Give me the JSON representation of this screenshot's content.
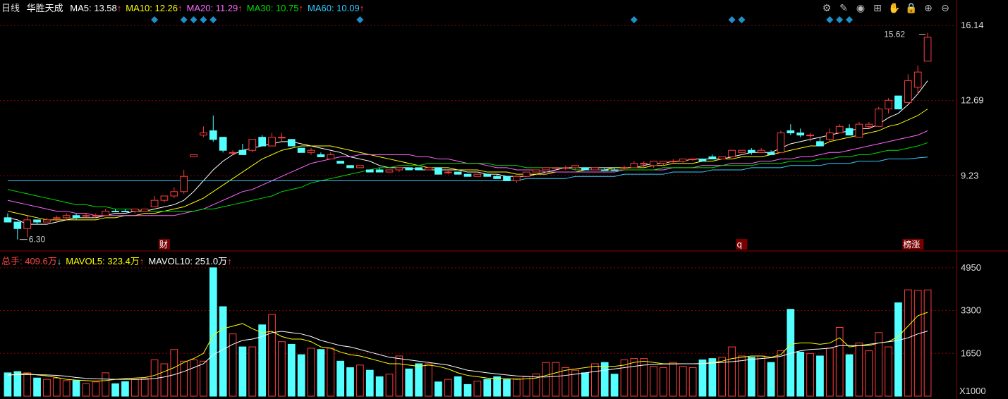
{
  "period_label": "日线",
  "stock_name": "华胜天成",
  "ma_legend": [
    {
      "label": "MA5: 13.58",
      "arrow": "↑",
      "color": "#ffffff"
    },
    {
      "label": "MA10: 12.26",
      "arrow": "↑",
      "color": "#ffff00"
    },
    {
      "label": "MA20: 11.29",
      "arrow": "↑",
      "color": "#ff66ff"
    },
    {
      "label": "MA30: 10.75",
      "arrow": "↑",
      "color": "#00dd00"
    },
    {
      "label": "MA60: 10.09",
      "arrow": "↑",
      "color": "#33ccff"
    }
  ],
  "vol_legend": [
    {
      "label": "总手: 409.6万",
      "arrow": "↓",
      "color": "#ff4444"
    },
    {
      "label": "MAVOL5: 323.4万",
      "arrow": "↑",
      "color": "#ffff00"
    },
    {
      "label": "MAVOL10: 251.0万",
      "arrow": "↑",
      "color": "#ffffff"
    }
  ],
  "toolbar": [
    "gear-icon",
    "pen-icon",
    "eye-icon",
    "gift-icon",
    "hand-icon",
    "lock-icon",
    "zoom-in-icon",
    "zoom-out-icon"
  ],
  "toolbar_glyphs": [
    "⚙",
    "✎",
    "◉",
    "⊞",
    "✋",
    "🔒",
    "⊕",
    "⊖"
  ],
  "colors": {
    "up": "#ff3c3c",
    "down": "#54ffff",
    "bg": "#000000",
    "grid": "#8b0000",
    "axis_text": "#dddddd"
  },
  "chart_data": {
    "type": "candlestick",
    "price_axis": {
      "ticks": [
        "16.14",
        "12.69",
        "9.23"
      ],
      "range": [
        5.9,
        16.6
      ]
    },
    "volume_axis": {
      "ticks": [
        "4950",
        "3300",
        "1650"
      ],
      "unit_label": "X1000",
      "range": [
        0,
        5000
      ]
    },
    "annotations": {
      "high_label": "15.62",
      "low_label": "6.30",
      "events": [
        "财",
        "q",
        "榜涨"
      ]
    },
    "candles": [
      [
        7.3,
        7.5,
        7.2,
        7.1,
        "d",
        900
      ],
      [
        7.1,
        7.1,
        6.3,
        6.8,
        "d",
        950
      ],
      [
        6.8,
        7.4,
        6.4,
        7.2,
        "u",
        900
      ],
      [
        7.2,
        7.2,
        7.0,
        7.1,
        "d",
        700
      ],
      [
        7.1,
        7.3,
        7.1,
        7.2,
        "u",
        650
      ],
      [
        7.3,
        7.4,
        7.1,
        7.3,
        "u",
        700
      ],
      [
        7.3,
        7.5,
        7.2,
        7.4,
        "u",
        600
      ],
      [
        7.4,
        7.5,
        7.2,
        7.3,
        "d",
        600
      ],
      [
        7.4,
        7.5,
        7.3,
        7.4,
        "u",
        480
      ],
      [
        7.4,
        7.5,
        7.3,
        7.4,
        "u",
        550
      ],
      [
        7.4,
        7.7,
        7.4,
        7.6,
        "u",
        900
      ],
      [
        7.6,
        7.7,
        7.6,
        7.6,
        "d",
        480
      ],
      [
        7.6,
        7.7,
        7.6,
        7.6,
        "d",
        560
      ],
      [
        7.6,
        7.7,
        7.5,
        7.7,
        "u",
        640
      ],
      [
        7.6,
        7.7,
        7.6,
        7.7,
        "u",
        700
      ],
      [
        7.8,
        8.3,
        7.8,
        8.1,
        "u",
        1400
      ],
      [
        8.1,
        8.3,
        8.0,
        8.3,
        "u",
        1250
      ],
      [
        8.3,
        8.7,
        8.2,
        8.5,
        "u",
        1800
      ],
      [
        8.5,
        9.5,
        8.4,
        9.2,
        "u",
        1350
      ],
      [
        10.1,
        10.2,
        10.1,
        10.2,
        "u",
        1400
      ],
      [
        11.1,
        11.5,
        11.0,
        11.2,
        "u",
        1350
      ],
      [
        11.3,
        12.0,
        10.8,
        10.9,
        "d",
        4950
      ],
      [
        11.0,
        11.0,
        10.3,
        10.4,
        "d",
        3450
      ],
      [
        10.3,
        10.4,
        10.2,
        10.3,
        "u",
        2400
      ],
      [
        10.4,
        10.7,
        10.2,
        10.2,
        "d",
        1900
      ],
      [
        10.4,
        10.9,
        10.3,
        10.9,
        "u",
        1900
      ],
      [
        11.0,
        11.1,
        10.6,
        10.6,
        "d",
        2750
      ],
      [
        10.6,
        11.2,
        10.6,
        11.0,
        "u",
        3150
      ],
      [
        11.0,
        11.2,
        10.8,
        11.0,
        "u",
        2100
      ],
      [
        10.9,
        10.9,
        10.6,
        10.6,
        "d",
        2000
      ],
      [
        10.5,
        10.5,
        10.3,
        10.3,
        "d",
        1600
      ],
      [
        10.3,
        10.5,
        10.2,
        10.4,
        "u",
        1850
      ],
      [
        10.2,
        10.3,
        10.1,
        10.1,
        "d",
        1800
      ],
      [
        10.0,
        10.3,
        10.0,
        10.2,
        "u",
        1850
      ],
      [
        9.9,
        9.9,
        9.8,
        9.8,
        "d",
        1350
      ],
      [
        9.7,
        9.7,
        9.6,
        9.6,
        "d",
        1100
      ],
      [
        9.6,
        9.7,
        9.6,
        9.7,
        "u",
        1200
      ],
      [
        9.5,
        9.5,
        9.4,
        9.4,
        "d",
        1000
      ],
      [
        9.5,
        9.6,
        9.4,
        9.4,
        "d",
        750
      ],
      [
        9.4,
        9.5,
        9.4,
        9.5,
        "u",
        850
      ],
      [
        9.5,
        9.6,
        9.4,
        9.6,
        "u",
        1550
      ],
      [
        9.6,
        9.6,
        9.5,
        9.5,
        "d",
        1050
      ],
      [
        9.6,
        9.6,
        9.5,
        9.5,
        "d",
        1250
      ],
      [
        9.5,
        9.6,
        9.5,
        9.6,
        "u",
        1250
      ],
      [
        9.6,
        9.6,
        9.3,
        9.3,
        "d",
        550
      ],
      [
        9.4,
        9.5,
        9.3,
        9.4,
        "u",
        650
      ],
      [
        9.4,
        9.4,
        9.3,
        9.3,
        "d",
        750
      ],
      [
        9.3,
        9.3,
        9.2,
        9.2,
        "d",
        450
      ],
      [
        9.2,
        9.3,
        9.2,
        9.3,
        "u",
        580
      ],
      [
        9.3,
        9.3,
        9.2,
        9.2,
        "d",
        650
      ],
      [
        9.2,
        9.3,
        9.1,
        9.1,
        "d",
        750
      ],
      [
        9.2,
        9.2,
        9.0,
        9.0,
        "d",
        640
      ],
      [
        9.0,
        9.2,
        8.9,
        9.2,
        "u",
        670
      ],
      [
        9.2,
        9.4,
        9.2,
        9.4,
        "u",
        750
      ],
      [
        9.4,
        9.5,
        9.4,
        9.5,
        "u",
        860
      ],
      [
        9.5,
        9.6,
        9.5,
        9.6,
        "u",
        1300
      ],
      [
        9.6,
        9.6,
        9.6,
        9.6,
        "u",
        1300
      ],
      [
        9.6,
        9.7,
        9.5,
        9.6,
        "u",
        1100
      ],
      [
        9.6,
        9.7,
        9.5,
        9.7,
        "u",
        1000
      ],
      [
        9.6,
        9.6,
        9.5,
        9.5,
        "d",
        900
      ],
      [
        9.5,
        9.6,
        9.5,
        9.6,
        "u",
        1250
      ],
      [
        9.5,
        9.6,
        9.5,
        9.5,
        "d",
        1300
      ],
      [
        9.5,
        9.6,
        9.5,
        9.5,
        "d",
        850
      ],
      [
        9.6,
        9.7,
        9.5,
        9.6,
        "u",
        1400
      ],
      [
        9.6,
        9.9,
        9.6,
        9.8,
        "u",
        1450
      ],
      [
        9.8,
        9.9,
        9.6,
        9.8,
        "u",
        1450
      ],
      [
        9.7,
        9.9,
        9.6,
        9.9,
        "u",
        1150
      ],
      [
        9.9,
        9.9,
        9.7,
        9.8,
        "u",
        1100
      ],
      [
        9.9,
        10.0,
        9.8,
        9.9,
        "u",
        1300
      ],
      [
        9.9,
        10.0,
        9.8,
        10.0,
        "u",
        1150
      ],
      [
        10.0,
        10.0,
        9.9,
        10.0,
        "u",
        1100
      ],
      [
        10.0,
        10.0,
        9.9,
        9.9,
        "d",
        1400
      ],
      [
        10.1,
        10.2,
        10.0,
        10.0,
        "d",
        1450
      ],
      [
        10.0,
        10.1,
        10.0,
        10.1,
        "u",
        1500
      ],
      [
        10.1,
        10.4,
        10.1,
        10.4,
        "u",
        1900
      ],
      [
        10.3,
        10.4,
        10.3,
        10.4,
        "u",
        1550
      ],
      [
        10.4,
        10.5,
        10.2,
        10.3,
        "d",
        1500
      ],
      [
        10.3,
        10.5,
        10.3,
        10.4,
        "u",
        1550
      ],
      [
        10.3,
        10.4,
        10.2,
        10.2,
        "d",
        1300
      ],
      [
        10.3,
        11.3,
        10.3,
        11.2,
        "u",
        1750
      ],
      [
        11.3,
        11.6,
        11.1,
        11.2,
        "d",
        3350
      ],
      [
        11.2,
        11.4,
        11.0,
        11.1,
        "d",
        1700
      ],
      [
        11.1,
        11.2,
        10.8,
        11.1,
        "u",
        1650
      ],
      [
        10.8,
        11.0,
        10.6,
        10.6,
        "d",
        1550
      ],
      [
        10.9,
        11.4,
        10.8,
        11.2,
        "u",
        1850
      ],
      [
        11.2,
        11.6,
        11.2,
        11.5,
        "u",
        2650
      ],
      [
        11.4,
        11.6,
        11.1,
        11.1,
        "d",
        1600
      ],
      [
        11.0,
        11.7,
        11.0,
        11.6,
        "u",
        2050
      ],
      [
        11.6,
        11.7,
        11.4,
        11.5,
        "u",
        1750
      ],
      [
        11.5,
        12.4,
        11.5,
        12.3,
        "u",
        2450
      ],
      [
        12.3,
        12.8,
        12.1,
        12.7,
        "u",
        1900
      ],
      [
        12.9,
        12.9,
        12.3,
        12.3,
        "d",
        3600
      ],
      [
        12.6,
        13.9,
        12.6,
        13.6,
        "u",
        4100
      ],
      [
        13.3,
        14.3,
        13.0,
        14.0,
        "u",
        4080
      ],
      [
        14.5,
        15.8,
        14.5,
        15.6,
        "u",
        4096
      ]
    ],
    "ma5": [
      7.3,
      7.2,
      7.0,
      7.0,
      7.0,
      7.1,
      7.2,
      7.3,
      7.3,
      7.3,
      7.4,
      7.5,
      7.5,
      7.6,
      7.6,
      7.7,
      7.8,
      7.9,
      8.1,
      8.5,
      9.0,
      9.5,
      9.9,
      10.2,
      10.4,
      10.5,
      10.6,
      10.7,
      10.8,
      10.8,
      10.7,
      10.6,
      10.5,
      10.4,
      10.3,
      10.1,
      10.0,
      9.9,
      9.7,
      9.6,
      9.6,
      9.6,
      9.5,
      9.5,
      9.5,
      9.5,
      9.5,
      9.4,
      9.4,
      9.3,
      9.3,
      9.2,
      9.2,
      9.2,
      9.3,
      9.4,
      9.5,
      9.6,
      9.6,
      9.6,
      9.6,
      9.6,
      9.6,
      9.6,
      9.6,
      9.7,
      9.8,
      9.8,
      9.9,
      9.9,
      10.0,
      10.0,
      10.0,
      10.0,
      10.1,
      10.2,
      10.3,
      10.3,
      10.3,
      10.5,
      10.7,
      10.8,
      10.9,
      11.0,
      11.1,
      11.2,
      11.3,
      11.4,
      11.4,
      11.6,
      11.9,
      12.1,
      12.5,
      13.0,
      13.6
    ],
    "ma10": [
      7.6,
      7.5,
      7.4,
      7.3,
      7.2,
      7.2,
      7.2,
      7.2,
      7.2,
      7.2,
      7.3,
      7.3,
      7.4,
      7.4,
      7.5,
      7.5,
      7.6,
      7.7,
      7.8,
      8.0,
      8.2,
      8.5,
      8.8,
      9.1,
      9.4,
      9.7,
      10.0,
      10.2,
      10.4,
      10.5,
      10.6,
      10.6,
      10.6,
      10.6,
      10.5,
      10.4,
      10.3,
      10.2,
      10.1,
      10.0,
      9.9,
      9.8,
      9.7,
      9.6,
      9.6,
      9.6,
      9.5,
      9.5,
      9.5,
      9.4,
      9.4,
      9.4,
      9.3,
      9.3,
      9.3,
      9.3,
      9.4,
      9.4,
      9.4,
      9.5,
      9.5,
      9.5,
      9.6,
      9.6,
      9.6,
      9.6,
      9.7,
      9.7,
      9.8,
      9.8,
      9.8,
      9.9,
      9.9,
      10.0,
      10.0,
      10.1,
      10.1,
      10.1,
      10.2,
      10.3,
      10.4,
      10.5,
      10.6,
      10.6,
      10.8,
      10.9,
      11.0,
      11.1,
      11.2,
      11.3,
      11.5,
      11.6,
      11.8,
      12.0,
      12.3
    ],
    "ma20": [
      8.1,
      8.0,
      7.9,
      7.8,
      7.7,
      7.6,
      7.6,
      7.5,
      7.5,
      7.4,
      7.4,
      7.4,
      7.4,
      7.4,
      7.4,
      7.4,
      7.4,
      7.4,
      7.5,
      7.6,
      7.7,
      7.9,
      8.1,
      8.3,
      8.5,
      8.6,
      8.8,
      9.0,
      9.2,
      9.4,
      9.6,
      9.8,
      9.9,
      10.0,
      10.1,
      10.1,
      10.2,
      10.2,
      10.2,
      10.2,
      10.2,
      10.2,
      10.1,
      10.1,
      10.0,
      10.0,
      9.9,
      9.8,
      9.8,
      9.7,
      9.6,
      9.6,
      9.5,
      9.5,
      9.5,
      9.4,
      9.4,
      9.4,
      9.4,
      9.4,
      9.4,
      9.4,
      9.4,
      9.5,
      9.5,
      9.5,
      9.5,
      9.5,
      9.6,
      9.6,
      9.6,
      9.7,
      9.7,
      9.7,
      9.8,
      9.8,
      9.8,
      9.9,
      9.9,
      10.0,
      10.0,
      10.1,
      10.1,
      10.2,
      10.3,
      10.3,
      10.4,
      10.5,
      10.6,
      10.7,
      10.8,
      10.9,
      11.0,
      11.1,
      11.3
    ],
    "ma30": [
      8.6,
      8.5,
      8.4,
      8.3,
      8.2,
      8.1,
      8.0,
      7.9,
      7.9,
      7.8,
      7.8,
      7.7,
      7.7,
      7.7,
      7.6,
      7.6,
      7.6,
      7.6,
      7.6,
      7.6,
      7.7,
      7.7,
      7.8,
      7.9,
      8.0,
      8.1,
      8.2,
      8.3,
      8.5,
      8.6,
      8.7,
      8.9,
      9.0,
      9.1,
      9.2,
      9.3,
      9.4,
      9.5,
      9.6,
      9.6,
      9.7,
      9.7,
      9.7,
      9.8,
      9.8,
      9.8,
      9.8,
      9.8,
      9.8,
      9.8,
      9.7,
      9.7,
      9.7,
      9.6,
      9.6,
      9.6,
      9.6,
      9.6,
      9.5,
      9.5,
      9.5,
      9.5,
      9.5,
      9.5,
      9.5,
      9.5,
      9.5,
      9.6,
      9.6,
      9.6,
      9.6,
      9.6,
      9.6,
      9.7,
      9.7,
      9.7,
      9.7,
      9.8,
      9.8,
      9.8,
      9.9,
      9.9,
      9.9,
      10.0,
      10.0,
      10.1,
      10.1,
      10.2,
      10.2,
      10.3,
      10.4,
      10.4,
      10.5,
      10.6,
      10.75
    ],
    "ma60": [
      9.0,
      9.0,
      9.0,
      9.0,
      9.0,
      9.0,
      9.0,
      9.0,
      9.0,
      9.0,
      9.0,
      9.0,
      9.0,
      9.0,
      9.0,
      9.0,
      9.0,
      9.0,
      9.0,
      9.0,
      9.0,
      9.0,
      9.0,
      9.0,
      9.0,
      9.0,
      9.0,
      9.0,
      9.0,
      9.0,
      9.0,
      9.0,
      9.0,
      9.0,
      9.0,
      9.0,
      9.0,
      9.0,
      9.0,
      9.0,
      9.0,
      9.0,
      9.0,
      9.0,
      9.0,
      9.0,
      9.0,
      9.0,
      9.0,
      9.0,
      9.0,
      9.0,
      9.0,
      9.1,
      9.1,
      9.1,
      9.1,
      9.1,
      9.2,
      9.2,
      9.2,
      9.2,
      9.2,
      9.3,
      9.3,
      9.3,
      9.3,
      9.3,
      9.4,
      9.4,
      9.4,
      9.4,
      9.5,
      9.5,
      9.5,
      9.5,
      9.6,
      9.6,
      9.6,
      9.6,
      9.7,
      9.7,
      9.7,
      9.7,
      9.8,
      9.8,
      9.8,
      9.9,
      9.9,
      9.9,
      10.0,
      10.0,
      10.0,
      10.05,
      10.09
    ],
    "mavol5": [
      800,
      850,
      870,
      820,
      780,
      720,
      650,
      620,
      600,
      580,
      600,
      650,
      680,
      700,
      720,
      800,
      950,
      1100,
      1300,
      1450,
      1650,
      2350,
      2600,
      2700,
      2800,
      2600,
      2450,
      2500,
      2300,
      2200,
      2200,
      2100,
      1900,
      1850,
      1700,
      1600,
      1550,
      1450,
      1350,
      1250,
      1250,
      1200,
      1150,
      1200,
      1150,
      1050,
      900,
      800,
      750,
      700,
      680,
      680,
      650,
      670,
      700,
      800,
      900,
      1000,
      1050,
      1100,
      1150,
      1150,
      1150,
      1200,
      1300,
      1350,
      1300,
      1250,
      1250,
      1250,
      1250,
      1250,
      1300,
      1350,
      1450,
      1500,
      1550,
      1550,
      1500,
      1600,
      2000,
      2050,
      2050,
      2000,
      2050,
      2250,
      1900,
      1950,
      1950,
      2050,
      2100,
      2300,
      2700,
      3100,
      3234
    ],
    "mavol10": [
      820,
      830,
      840,
      830,
      820,
      800,
      770,
      720,
      690,
      670,
      660,
      650,
      650,
      650,
      650,
      680,
      740,
      830,
      950,
      1100,
      1250,
      1600,
      1800,
      2000,
      2150,
      2200,
      2300,
      2450,
      2500,
      2450,
      2400,
      2300,
      2150,
      2050,
      1950,
      1900,
      1800,
      1700,
      1600,
      1500,
      1450,
      1400,
      1350,
      1300,
      1250,
      1200,
      1100,
      1000,
      950,
      900,
      860,
      820,
      780,
      760,
      740,
      740,
      760,
      800,
      850,
      900,
      950,
      1000,
      1050,
      1100,
      1150,
      1200,
      1220,
      1240,
      1240,
      1250,
      1250,
      1260,
      1280,
      1300,
      1330,
      1370,
      1420,
      1450,
      1480,
      1540,
      1650,
      1750,
      1800,
      1820,
      1850,
      1950,
      1950,
      1950,
      2000,
      2050,
      2100,
      2150,
      2250,
      2400,
      2510
    ]
  }
}
